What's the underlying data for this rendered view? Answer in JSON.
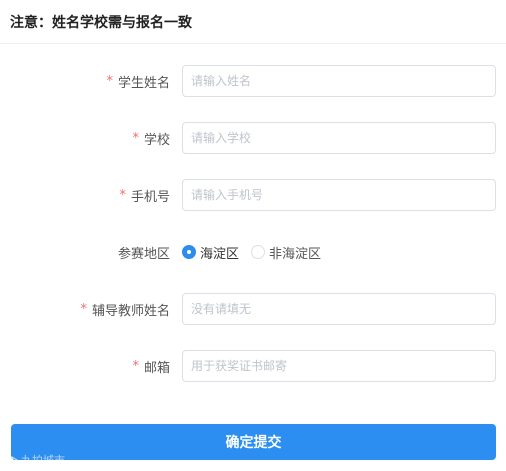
{
  "notice": "注意：姓名学校需与报名一致",
  "form": {
    "student_name": {
      "label": "学生姓名",
      "required": true,
      "placeholder": "请输入姓名"
    },
    "school": {
      "label": "学校",
      "required": true,
      "placeholder": "请输入学校"
    },
    "phone": {
      "label": "手机号",
      "required": true,
      "placeholder": "请输入手机号"
    },
    "region": {
      "label": "参赛地区",
      "options": [
        "海淀区",
        "非海淀区"
      ],
      "selected": "海淀区"
    },
    "teacher": {
      "label": "辅导教师姓名",
      "required": true,
      "placeholder": "没有请填无"
    },
    "email": {
      "label": "邮箱",
      "required": true,
      "placeholder": "用于获奖证书邮寄"
    }
  },
  "required_mark": "*",
  "submit_label": "确定提交",
  "watermark": "九拍城市",
  "colors": {
    "accent": "#2b8ef0",
    "required": "#f56c6c",
    "border": "#dcdfe6"
  }
}
